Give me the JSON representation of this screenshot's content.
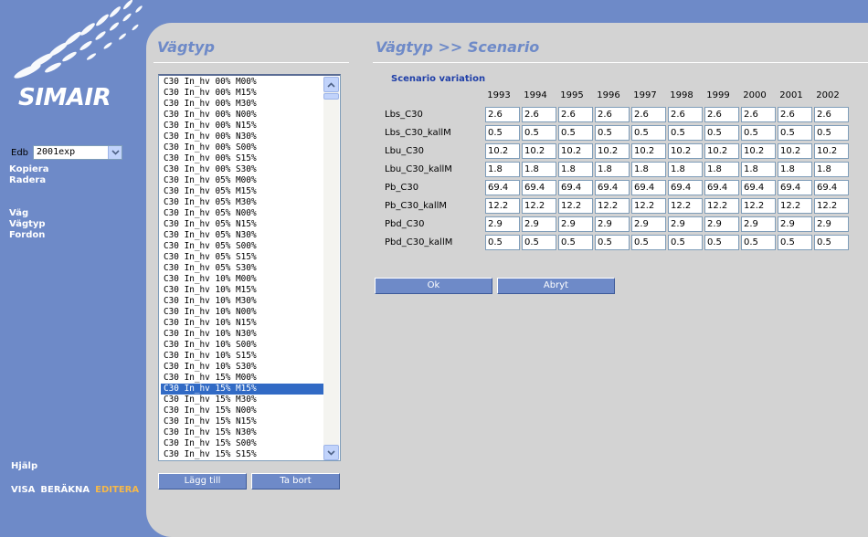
{
  "app": {
    "logo_text": "SIMAIR",
    "edb_label": "Edb",
    "edb_value": "2001exp",
    "links_top": [
      "Kopiera",
      "Radera"
    ],
    "links_nav": [
      "Väg",
      "Vägtyp",
      "Fordon"
    ],
    "help": "Hjälp",
    "modes": [
      {
        "label": "VISA",
        "active": false
      },
      {
        "label": "BERÄKNA",
        "active": false
      },
      {
        "label": "EDITERA",
        "active": true
      }
    ]
  },
  "left_panel": {
    "title": "Vägtyp",
    "items": [
      "C30 In_hv 00% M00%",
      "C30 In_hv 00% M15%",
      "C30 In_hv 00% M30%",
      "C30 In_hv 00% N00%",
      "C30 In_hv 00% N15%",
      "C30 In_hv 00% N30%",
      "C30 In_hv 00% S00%",
      "C30 In_hv 00% S15%",
      "C30 In_hv 00% S30%",
      "C30 In_hv 05% M00%",
      "C30 In_hv 05% M15%",
      "C30 In_hv 05% M30%",
      "C30 In_hv 05% N00%",
      "C30 In_hv 05% N15%",
      "C30 In_hv 05% N30%",
      "C30 In_hv 05% S00%",
      "C30 In_hv 05% S15%",
      "C30 In_hv 05% S30%",
      "C30 In_hv 10% M00%",
      "C30 In_hv 10% M15%",
      "C30 In_hv 10% M30%",
      "C30 In_hv 10% N00%",
      "C30 In_hv 10% N15%",
      "C30 In_hv 10% N30%",
      "C30 In_hv 10% S00%",
      "C30 In_hv 10% S15%",
      "C30 In_hv 10% S30%",
      "C30 In_hv 15% M00%",
      "C30 In_hv 15% M15%",
      "C30 In_hv 15% M30%",
      "C30 In_hv 15% N00%",
      "C30 In_hv 15% N15%",
      "C30 In_hv 15% N30%",
      "C30 In_hv 15% S00%",
      "C30 In_hv 15% S15%"
    ],
    "selected_index": 28,
    "add_button": "Lägg till",
    "remove_button": "Ta bort"
  },
  "right_panel": {
    "title": "Vägtyp >> Scenario",
    "section_label": "Scenario variation",
    "years": [
      "1993",
      "1994",
      "1995",
      "1996",
      "1997",
      "1998",
      "1999",
      "2000",
      "2001",
      "2002"
    ],
    "rows": [
      {
        "label": "Lbs_C30",
        "values": [
          "2.6",
          "2.6",
          "2.6",
          "2.6",
          "2.6",
          "2.6",
          "2.6",
          "2.6",
          "2.6",
          "2.6"
        ]
      },
      {
        "label": "Lbs_C30_kallM",
        "values": [
          "0.5",
          "0.5",
          "0.5",
          "0.5",
          "0.5",
          "0.5",
          "0.5",
          "0.5",
          "0.5",
          "0.5"
        ]
      },
      {
        "label": "Lbu_C30",
        "values": [
          "10.2",
          "10.2",
          "10.2",
          "10.2",
          "10.2",
          "10.2",
          "10.2",
          "10.2",
          "10.2",
          "10.2"
        ]
      },
      {
        "label": "Lbu_C30_kallM",
        "values": [
          "1.8",
          "1.8",
          "1.8",
          "1.8",
          "1.8",
          "1.8",
          "1.8",
          "1.8",
          "1.8",
          "1.8"
        ]
      },
      {
        "label": "Pb_C30",
        "values": [
          "69.4",
          "69.4",
          "69.4",
          "69.4",
          "69.4",
          "69.4",
          "69.4",
          "69.4",
          "69.4",
          "69.4"
        ]
      },
      {
        "label": "Pb_C30_kallM",
        "values": [
          "12.2",
          "12.2",
          "12.2",
          "12.2",
          "12.2",
          "12.2",
          "12.2",
          "12.2",
          "12.2",
          "12.2"
        ]
      },
      {
        "label": "Pbd_C30",
        "values": [
          "2.9",
          "2.9",
          "2.9",
          "2.9",
          "2.9",
          "2.9",
          "2.9",
          "2.9",
          "2.9",
          "2.9"
        ]
      },
      {
        "label": "Pbd_C30_kallM",
        "values": [
          "0.5",
          "0.5",
          "0.5",
          "0.5",
          "0.5",
          "0.5",
          "0.5",
          "0.5",
          "0.5",
          "0.5"
        ]
      }
    ],
    "ok_button": "Ok",
    "cancel_button": "Abryt"
  }
}
